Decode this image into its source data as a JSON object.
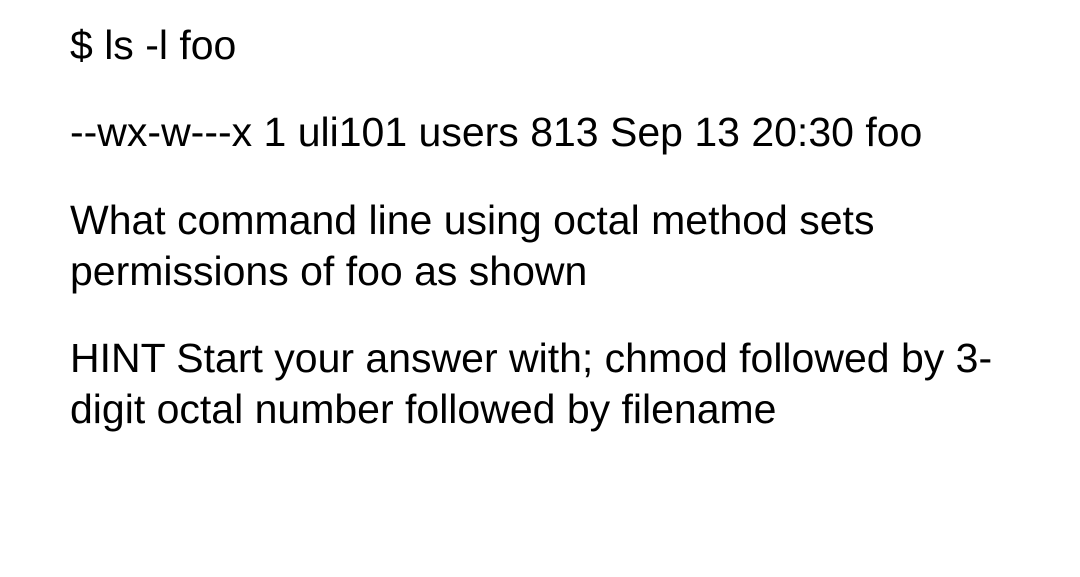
{
  "question": {
    "command_line": "$ ls -l foo",
    "ls_output": "--wx-w---x 1 uli101 users 813 Sep 13 20:30 foo",
    "prompt": "What command line using octal method sets permissions of foo as shown",
    "hint": "HINT Start your answer with;  chmod followed by 3-digit octal number followed by filename"
  }
}
